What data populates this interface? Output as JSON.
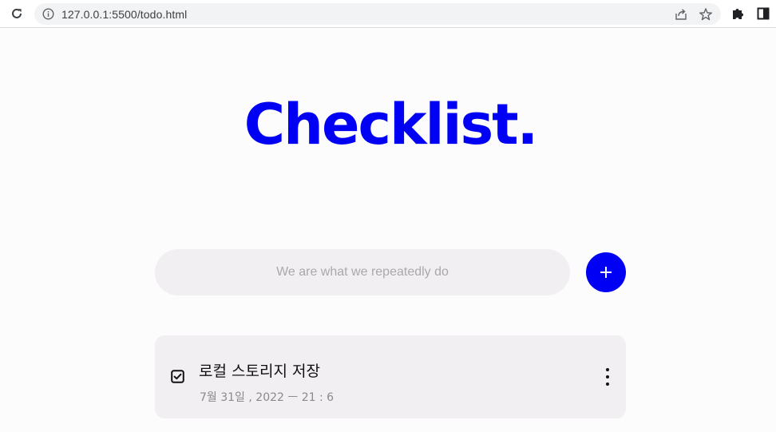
{
  "browser": {
    "url": "127.0.0.1:5500/todo.html"
  },
  "page": {
    "title": "Checklist.",
    "accent_color": "#0000f5",
    "input": {
      "placeholder": "We are what we repeatedly do",
      "value": ""
    },
    "add_button_label": "+",
    "todos": [
      {
        "text": "로컬 스토리지 저장",
        "date": "7월 31일 , 2022 ㅡ 21 : 6",
        "checked": true
      }
    ]
  },
  "icons": {
    "reload": "reload-icon",
    "info": "info-icon",
    "share": "share-icon",
    "bookmark": "star-icon",
    "extensions": "puzzle-icon",
    "side_panel": "side-panel-icon",
    "add": "plus-icon",
    "check": "checkbox-checked-icon",
    "more": "more-vertical-icon"
  }
}
